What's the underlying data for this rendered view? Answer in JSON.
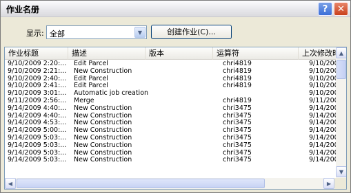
{
  "window": {
    "title": "作业名册"
  },
  "toolbar": {
    "show_label": "显示:",
    "filter_value": "全部",
    "create_button": "创建作业(C)..."
  },
  "table": {
    "columns": [
      "作业标题",
      "描述",
      "版本",
      "运算符",
      "上次修改时"
    ],
    "rows": [
      [
        "9/10/2009 2:20:...",
        "Edit Parcel",
        "",
        "chri4819",
        "9/10/200"
      ],
      [
        "9/10/2009 2:21:...",
        "New Construction",
        "",
        "chri4819",
        "9/10/200"
      ],
      [
        "9/10/2009 2:40:...",
        "Edit Parcel",
        "",
        "chri4819",
        "9/10/200"
      ],
      [
        "9/10/2009 2:41:...",
        "Edit Parcel",
        "",
        "chri4819",
        "9/10/200"
      ],
      [
        "9/10/2009 3:01:...",
        "Automatic job creation",
        "",
        "",
        "9/10/200"
      ],
      [
        "9/11/2009 2:56:...",
        "Merge",
        "",
        "chri4819",
        "9/11/200"
      ],
      [
        "9/14/2009 4:40:...",
        "New Construction",
        "",
        "chri3475",
        "9/14/200"
      ],
      [
        "9/14/2009 4:40:...",
        "New Construction",
        "",
        "chri3475",
        "9/14/200"
      ],
      [
        "9/14/2009 4:53:...",
        "New Construction",
        "",
        "chri3475",
        "9/14/200"
      ],
      [
        "9/14/2009 5:00:...",
        "New Construction",
        "",
        "chri3475",
        "9/14/200"
      ],
      [
        "9/14/2009 5:03:...",
        "New Construction",
        "",
        "chri3475",
        "9/14/200"
      ],
      [
        "9/14/2009 5:03:...",
        "New Construction",
        "",
        "chri3475",
        "9/14/200"
      ],
      [
        "9/14/2009 5:03:...",
        "New Construction",
        "",
        "chri3475",
        "9/14/200"
      ],
      [
        "9/14/2009 5:03:...",
        "New Construction",
        "",
        "chri3475",
        "9/14/200"
      ]
    ]
  },
  "icons": {
    "help": "help-icon",
    "close": "close-icon",
    "dropdown": "chevron-down-icon"
  }
}
